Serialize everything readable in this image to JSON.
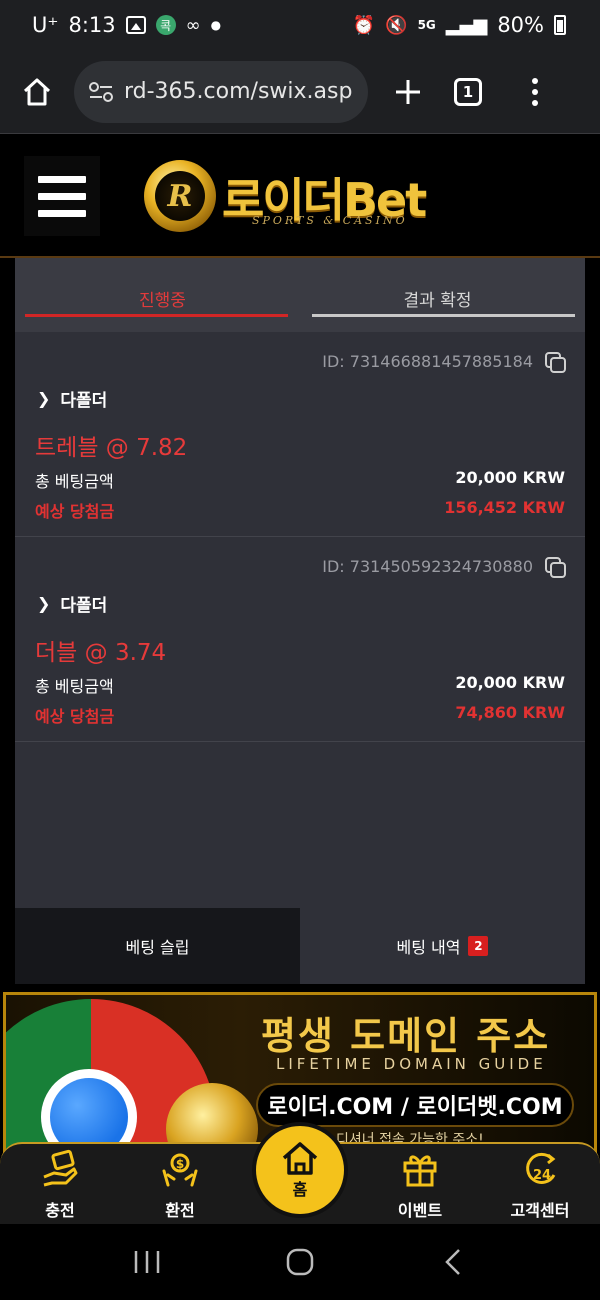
{
  "status_bar": {
    "carrier": "U⁺",
    "time": "8:13",
    "network": "5G",
    "battery": "80%"
  },
  "browser": {
    "url": "rd-365.com/swix.asp",
    "tab_count": "1"
  },
  "site": {
    "logo_name": "로이더Bet",
    "logo_letter": "R",
    "logo_sub": "SPORTS & CASINO"
  },
  "tabs": {
    "active": "진행중",
    "inactive": "결과 확정"
  },
  "bets": [
    {
      "id": "ID: 731466881457885184",
      "type": "다폴더",
      "odds": "트레블 @ 7.82",
      "total_label": "총 베팅금액",
      "total_value": "20,000 KRW",
      "expected_label": "예상 당첨금",
      "expected_value": "156,452 KRW"
    },
    {
      "id": "ID: 731450592324730880",
      "type": "다폴더",
      "odds": "더블 @ 3.74",
      "total_label": "총 베팅금액",
      "total_value": "20,000 KRW",
      "expected_label": "예상 당첨금",
      "expected_value": "74,860 KRW"
    }
  ],
  "bottom_tabs": {
    "slip": "베팅 슬립",
    "history": "베팅 내역",
    "history_count": "2"
  },
  "banner": {
    "title": "평생 도메인 주소",
    "subtitle": "LIFETIME DOMAIN GUIDE",
    "domain": "로이더.COM / 로이더벳.COM",
    "note": "디셔너 접속 가능한 주소!"
  },
  "nav": {
    "charge": "충전",
    "exchange": "환전",
    "home": "홈",
    "event": "이벤트",
    "support": "고객센터"
  },
  "colors": {
    "accent_red": "#e23232",
    "gold": "#f4c21b",
    "panel": "#2f3038"
  }
}
